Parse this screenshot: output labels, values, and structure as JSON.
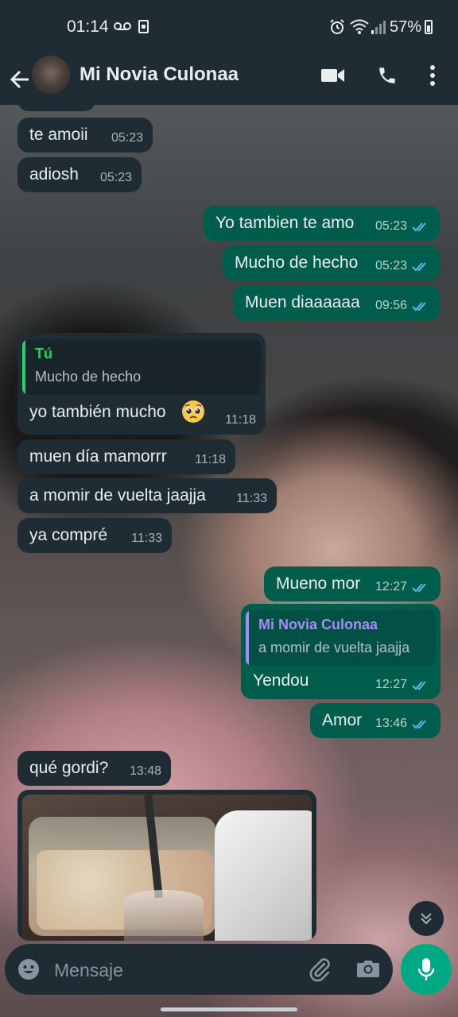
{
  "status_bar": {
    "time": "01:14",
    "battery": "57%"
  },
  "header": {
    "contact_name": "Mi Novia Culonaa"
  },
  "messages": [
    {
      "dir": "in",
      "text": "te amoii",
      "time": "05:23"
    },
    {
      "dir": "in",
      "text": "adiosh",
      "time": "05:23"
    },
    {
      "dir": "out",
      "text": "Yo tambien te amo",
      "time": "05:23",
      "read": true
    },
    {
      "dir": "out",
      "text": "Mucho de hecho",
      "time": "05:23",
      "read": true
    },
    {
      "dir": "out",
      "text": "Muen diaaaaaa",
      "time": "09:56",
      "read": true
    },
    {
      "dir": "in",
      "quote": {
        "author": "Tú",
        "text": "Mucho de hecho"
      },
      "text": "yo también mucho",
      "emoji": "pleading-face",
      "time": "11:18"
    },
    {
      "dir": "in",
      "text": "muen día mamorrr",
      "time": "11:18"
    },
    {
      "dir": "in",
      "text": "a momir de vuelta jaajja",
      "time": "11:33"
    },
    {
      "dir": "in",
      "text": "ya compré",
      "time": "11:33"
    },
    {
      "dir": "out",
      "text": "Mueno mor",
      "time": "12:27",
      "read": true
    },
    {
      "dir": "out",
      "quote": {
        "author": "Mi Novia Culonaa",
        "text": "a momir de vuelta jaajja"
      },
      "text": "Yendou",
      "time": "12:27",
      "read": true
    },
    {
      "dir": "out",
      "text": "Amor",
      "time": "13:46",
      "read": true
    },
    {
      "dir": "in",
      "text": "qué gordi?",
      "time": "13:48"
    }
  ],
  "input": {
    "placeholder": "Mensaje"
  },
  "colors": {
    "header_bg": "#202c33",
    "incoming_bubble": "#202c33",
    "outgoing_bubble": "#005c4b",
    "read_ticks": "#53bdeb",
    "accent_green": "#00a884",
    "quote_author_self": "#25d366",
    "quote_author_contact": "#a78bfa"
  },
  "icons": [
    "back-arrow-icon",
    "video-call-icon",
    "phone-icon",
    "more-vert-icon",
    "emoji-icon",
    "attach-icon",
    "camera-icon",
    "mic-icon",
    "chevron-down-icon",
    "double-check-icon"
  ]
}
